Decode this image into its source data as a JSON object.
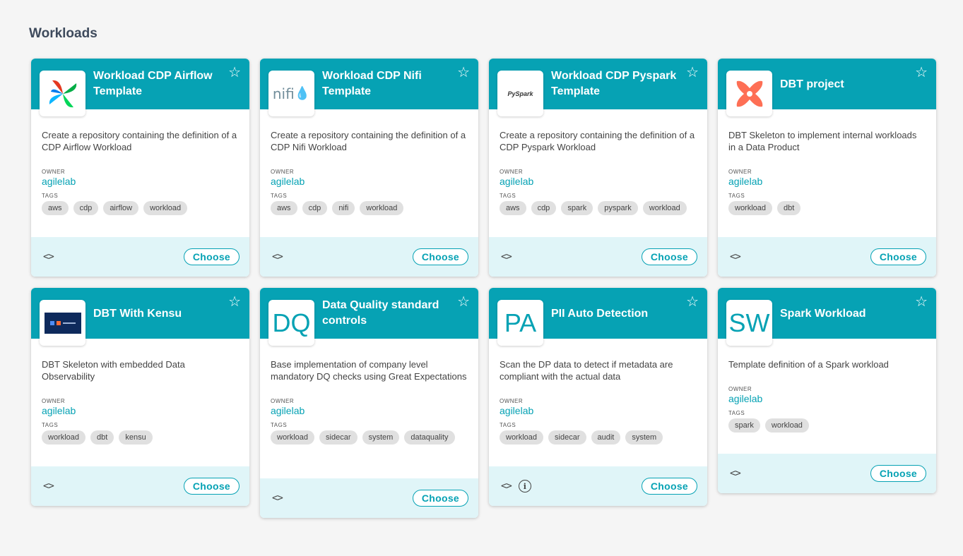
{
  "page": {
    "title": "Workloads"
  },
  "cards": [
    {
      "title": "Workload CDP Airflow Template",
      "description": "Create a repository containing the definition of a CDP Airflow Workload",
      "owner_label": "OWNER",
      "owner": "agilelab",
      "tags_label": "TAGS",
      "tags": [
        "aws",
        "cdp",
        "airflow",
        "workload"
      ],
      "logo": "airflow-logo",
      "choose_label": "Choose"
    },
    {
      "title": "Workload CDP Nifi Template",
      "description": "Create a repository containing the definition of a CDP Nifi Workload",
      "owner_label": "OWNER",
      "owner": "agilelab",
      "tags_label": "TAGS",
      "tags": [
        "aws",
        "cdp",
        "nifi",
        "workload"
      ],
      "logo": "nifi-logo",
      "logo_text": "nifi",
      "choose_label": "Choose"
    },
    {
      "title": "Workload CDP Pyspark Template",
      "description": "Create a repository containing the definition of a CDP Pyspark Workload",
      "owner_label": "OWNER",
      "owner": "agilelab",
      "tags_label": "TAGS",
      "tags": [
        "aws",
        "cdp",
        "spark",
        "pyspark",
        "workload"
      ],
      "logo": "pyspark-logo",
      "logo_text": "PySpark",
      "choose_label": "Choose"
    },
    {
      "title": "DBT project",
      "description": "DBT Skeleton to implement internal workloads in a Data Product",
      "owner_label": "OWNER",
      "owner": "agilelab",
      "tags_label": "TAGS",
      "tags": [
        "workload",
        "dbt"
      ],
      "logo": "dbt-logo",
      "choose_label": "Choose"
    },
    {
      "title": "DBT With Kensu",
      "description": "DBT Skeleton with embedded Data Observability",
      "owner_label": "OWNER",
      "owner": "agilelab",
      "tags_label": "TAGS",
      "tags": [
        "workload",
        "dbt",
        "kensu"
      ],
      "logo": "kensu-logo",
      "choose_label": "Choose"
    },
    {
      "title": "Data Quality standard controls",
      "description": "Base implementation of company level mandatory DQ checks using Great Expectations",
      "owner_label": "OWNER",
      "owner": "agilelab",
      "tags_label": "TAGS",
      "tags": [
        "workload",
        "sidecar",
        "system",
        "dataquality"
      ],
      "logo": "initials",
      "logo_text": "DQ",
      "choose_label": "Choose"
    },
    {
      "title": "PII Auto Detection",
      "description": "Scan the DP data to detect if metadata are compliant with the actual data",
      "owner_label": "OWNER",
      "owner": "agilelab",
      "tags_label": "TAGS",
      "tags": [
        "workload",
        "sidecar",
        "audit",
        "system"
      ],
      "logo": "initials",
      "logo_text": "PA",
      "has_info": true,
      "choose_label": "Choose"
    },
    {
      "title": "Spark Workload",
      "description": "Template definition of a Spark workload",
      "owner_label": "OWNER",
      "owner": "agilelab",
      "tags_label": "TAGS",
      "tags": [
        "spark",
        "workload"
      ],
      "logo": "initials",
      "logo_text": "SW",
      "choose_label": "Choose"
    }
  ],
  "icons": {
    "star": "star-outline-icon",
    "code": "code-icon",
    "info": "info-icon"
  },
  "colors": {
    "header": "#06a2b4",
    "footer": "#e0f5f8",
    "accent": "#06a2b4"
  }
}
